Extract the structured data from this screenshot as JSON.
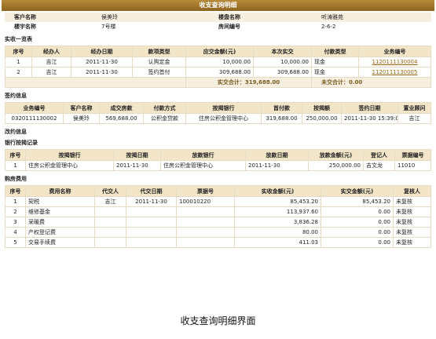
{
  "title": "收支查询明细",
  "info": {
    "customer_label": "客户名称",
    "customer": "侯美玲",
    "project_label": "楼盘名称",
    "project": "听涛雅苑",
    "building_label": "楼宇名称",
    "building": "7号楼",
    "room_label": "房间编号",
    "room": "2-6-2"
  },
  "receipts": {
    "section": "实收一览表",
    "headers": [
      "序号",
      "经办人",
      "经办日期",
      "款项类型",
      "应交金额(元)",
      "本次实交",
      "付款类型",
      "业务编号"
    ],
    "rows": [
      [
        "1",
        "吉江",
        "2011-11-30",
        "认购定金",
        "10,000.00",
        "10,000.00",
        "现金",
        "1120111130004"
      ],
      [
        "2",
        "吉江",
        "2011-11-30",
        "签约首付",
        "309,688.00",
        "309,688.00",
        "现金",
        "1120111130005"
      ]
    ],
    "total_label": "实交合计：",
    "total": "319,688.00",
    "unpaid_label": "未交合计：",
    "unpaid": "0.00"
  },
  "contract": {
    "section": "签约信息",
    "headers": [
      "业务编号",
      "客户名称",
      "成交房款",
      "付款方式",
      "按揭银行",
      "首付款",
      "按揭额",
      "签约日期",
      "置业顾问"
    ],
    "row": [
      "0320111130002",
      "侯美玲",
      "569,688.00",
      "公积金贷款",
      "住房公积金管理中心",
      "319,688.00",
      "250,000.00",
      "2011-11-30 15:39:00",
      "吉江"
    ]
  },
  "change_section": "改约信息",
  "mortgage": {
    "section": "银行按揭记录",
    "headers": [
      "序号",
      "按揭银行",
      "按揭日期",
      "放款银行",
      "放款日期",
      "放款金额(元)",
      "登记人",
      "票据编号"
    ],
    "row": [
      "1",
      "住房公积金管理中心",
      "2011-11-30",
      "住房公积金管理中心",
      "2011-11-30",
      "250,000.00",
      "吉文龙",
      "11010"
    ]
  },
  "fees": {
    "section": "购房费用",
    "headers": [
      "序号",
      "费用名称",
      "代交人",
      "代交日期",
      "票据号",
      "实收金额(元)",
      "实交金额(元)",
      "复核人"
    ],
    "rows": [
      [
        "1",
        "契税",
        "吉江",
        "2011-11-30",
        "100010220",
        "85,453.20",
        "85,453.20",
        "未复核"
      ],
      [
        "2",
        "维修基金",
        "",
        "",
        "",
        "113,937.60",
        "0.00",
        "未复核"
      ],
      [
        "3",
        "采暖费",
        "",
        "",
        "",
        "3,836.28",
        "0.00",
        "未复核"
      ],
      [
        "4",
        "产权登记费",
        "",
        "",
        "",
        "80.00",
        "0.00",
        "未复核"
      ],
      [
        "5",
        "交易手续费",
        "",
        "",
        "",
        "411.03",
        "0.00",
        "未复核"
      ]
    ]
  },
  "caption": "收支查询明细界面"
}
